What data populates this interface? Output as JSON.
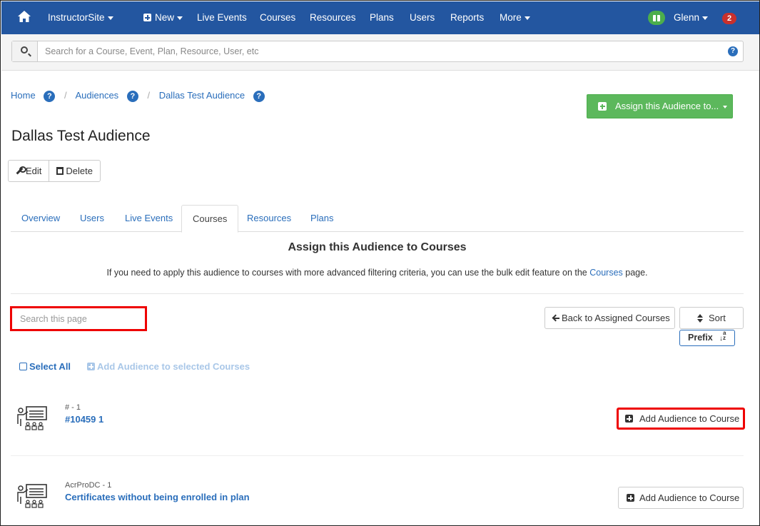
{
  "nav": {
    "brand": "InstructorSite",
    "items": [
      "New",
      "Live Events",
      "Courses",
      "Resources",
      "Plans",
      "Users",
      "Reports",
      "More"
    ],
    "user": "Glenn",
    "notifications": "2"
  },
  "search": {
    "placeholder": "Search for a Course, Event, Plan, Resource, User, etc",
    "help": "?"
  },
  "breadcrumb": [
    "Home",
    "Audiences",
    "Dallas Test Audience"
  ],
  "assign_button": "Assign this Audience to...",
  "page_title": "Dallas Test Audience",
  "actions": {
    "edit": "Edit",
    "delete": "Delete"
  },
  "tabs": [
    "Overview",
    "Users",
    "Live Events",
    "Courses",
    "Resources",
    "Plans"
  ],
  "active_tab": "Courses",
  "section": {
    "heading": "Assign this Audience to Courses",
    "text_before": "If you need to apply this audience to courses with more advanced filtering criteria, you can use the bulk edit feature on the ",
    "link": "Courses",
    "text_after": " page."
  },
  "local_search": {
    "placeholder": "Search this page"
  },
  "back_button": "Back to Assigned Courses",
  "sort": {
    "label": "Sort",
    "field": "Prefix",
    "direction_icon": "↓a z"
  },
  "select_all": "Select All",
  "add_selected": "Add Audience to selected Courses",
  "courses": [
    {
      "id": "# - 1",
      "name": "#10459 1",
      "action": "Add Audience to Course"
    },
    {
      "id": "AcrProDC - 1",
      "name": "Certificates without being enrolled in plan",
      "action": "Add Audience to Course"
    }
  ],
  "colors": {
    "nav": "#2356a0",
    "link": "#2a6ebb",
    "success": "#5cb85c",
    "highlight": "#ee0000"
  }
}
